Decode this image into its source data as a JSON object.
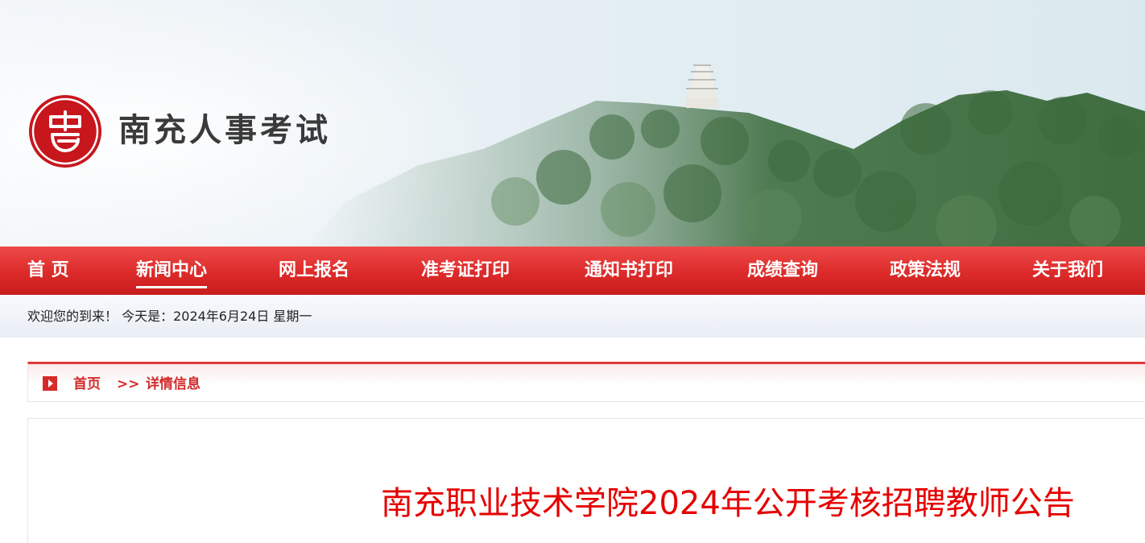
{
  "header": {
    "site_title": "南充人事考试",
    "logo_icon": "nanchong-seal-logo-icon"
  },
  "nav": {
    "items": [
      {
        "label": "首  页",
        "active": false
      },
      {
        "label": "新闻中心",
        "active": true
      },
      {
        "label": "网上报名",
        "active": false
      },
      {
        "label": "准考证打印",
        "active": false
      },
      {
        "label": "通知书打印",
        "active": false
      },
      {
        "label": "成绩查询",
        "active": false
      },
      {
        "label": "政策法规",
        "active": false
      },
      {
        "label": "关于我们",
        "active": false
      }
    ]
  },
  "welcome": {
    "text": "欢迎您的到来！ 今天是：2024年6月24日 星期一"
  },
  "breadcrumb": {
    "icon": "play-arrow-icon",
    "home": "首页",
    "separator": ">>",
    "current": "详情信息"
  },
  "article": {
    "title": "南充职业技术学院2024年公开考核招聘教师公告"
  },
  "colors": {
    "nav_red": "#dc2a2a",
    "title_red": "#e60000",
    "crumb_red": "#d12b2b",
    "logo_red": "#c8161d"
  }
}
